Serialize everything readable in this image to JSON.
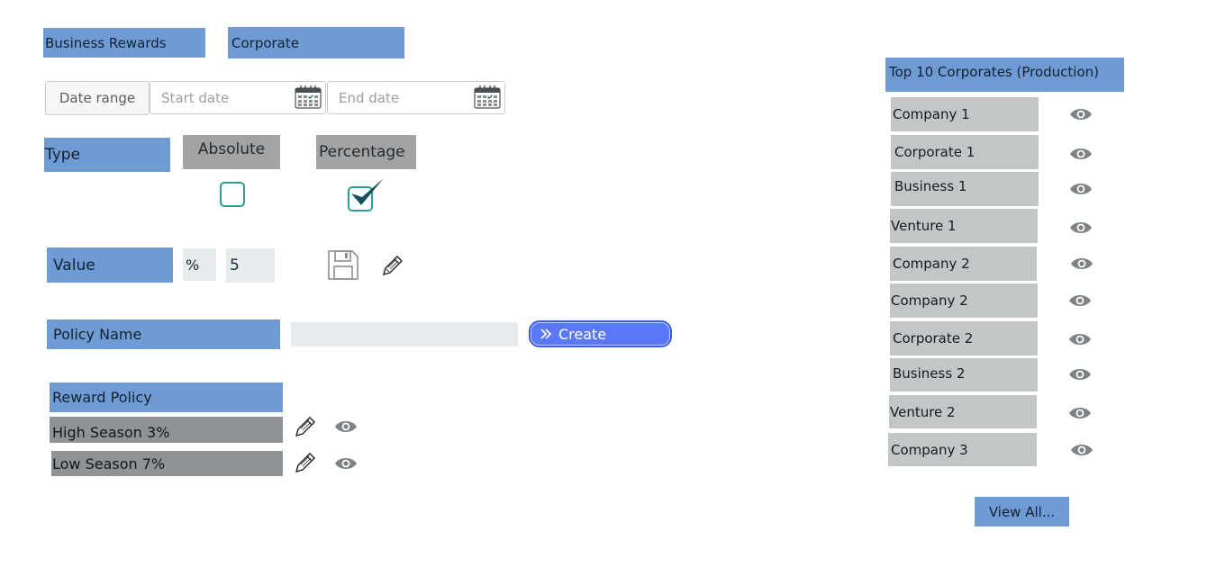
{
  "tabs": {
    "business_rewards": "Business Rewards",
    "corporate": "Corporate"
  },
  "date_filter": {
    "range_label": "Date range",
    "start_placeholder": "Start date",
    "end_placeholder": "End date"
  },
  "type": {
    "label": "Type",
    "absolute_label": "Absolute",
    "percentage_label": "Percentage",
    "absolute_checked": false,
    "percentage_checked": true
  },
  "value": {
    "label": "Value",
    "unit": "%",
    "amount": "5"
  },
  "policy_name": {
    "label": "Policy Name",
    "input_value": "",
    "create_label": "Create"
  },
  "reward_policy": {
    "header": "Reward Policy",
    "items": [
      {
        "label": "High Season 3%"
      },
      {
        "label": "Low Season 7%"
      }
    ]
  },
  "top_corporates": {
    "header": "Top 10 Corporates (Production)",
    "items": [
      {
        "label": "Company 1"
      },
      {
        "label": "Corporate 1"
      },
      {
        "label": "Business 1"
      },
      {
        "label": "Venture 1"
      },
      {
        "label": "Company 2"
      },
      {
        "label": "Company 2"
      },
      {
        "label": "Corporate 2"
      },
      {
        "label": "Business 2"
      },
      {
        "label": "Venture 2"
      },
      {
        "label": "Company 3"
      }
    ],
    "view_all_label": "View All..."
  },
  "colors": {
    "accent_blue": "#6f9bd4",
    "create_button": "#5a78f5",
    "checkbox_border": "#2a9d97",
    "check_mark": "#15505c",
    "list_grey": "#c3c6c7"
  },
  "icons": {
    "calendar": "calendar-icon",
    "save": "save-icon",
    "edit": "pencil-icon",
    "view": "eye-icon",
    "create": "double-chevron-right-icon",
    "checked": "checkmark-icon"
  }
}
